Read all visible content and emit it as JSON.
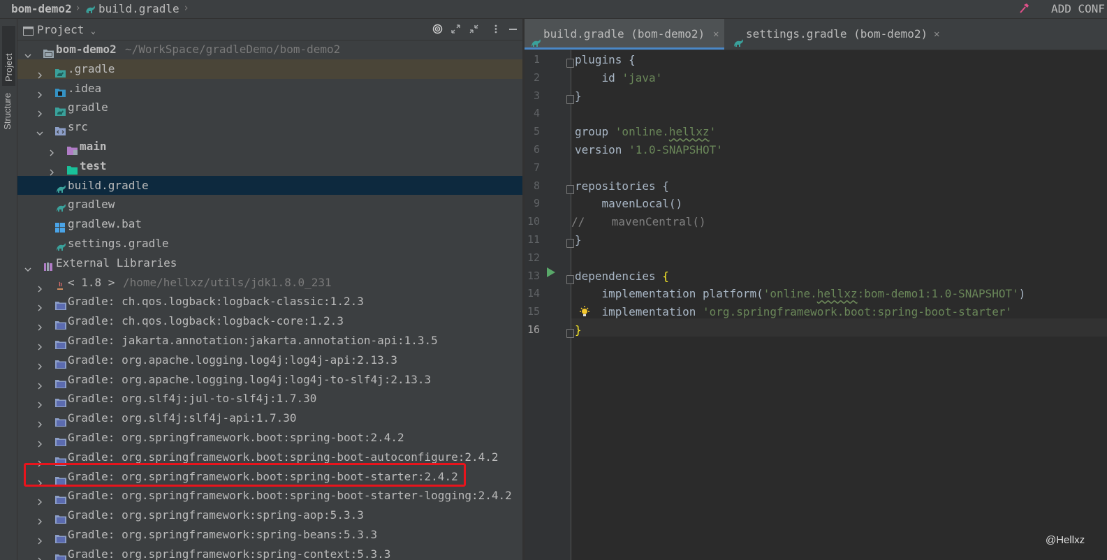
{
  "breadcrumb": {
    "project": "bom-demo2",
    "file": "build.gradle"
  },
  "top_right_label": "ADD CONF",
  "tool_stripe": {
    "project_tab": "Project",
    "structure_tab": "Structure"
  },
  "project_panel": {
    "title": "Project",
    "tree": [
      {
        "label": "bom-demo2",
        "path": "~/WorkSpace/gradleDemo/bom-demo2",
        "indent": 0,
        "expanded": true,
        "icon": "module-folder-icon",
        "bold": true
      },
      {
        "label": ".gradle",
        "indent": 1,
        "expanded": false,
        "icon": "gradle-folder-icon",
        "highlight": true
      },
      {
        "label": ".idea",
        "indent": 1,
        "expanded": false,
        "icon": "idea-folder-icon"
      },
      {
        "label": "gradle",
        "indent": 1,
        "expanded": false,
        "icon": "gradle-folder-icon"
      },
      {
        "label": "src",
        "indent": 1,
        "expanded": true,
        "icon": "source-folder-icon"
      },
      {
        "label": "main",
        "indent": 2,
        "expanded": false,
        "icon": "main-folder-icon",
        "bold": true
      },
      {
        "label": "test",
        "indent": 2,
        "expanded": false,
        "icon": "test-folder-icon",
        "bold": true
      },
      {
        "label": "build.gradle",
        "indent": 1,
        "icon": "gradle-file-icon",
        "selected": true
      },
      {
        "label": "gradlew",
        "indent": 1,
        "icon": "gradle-file-icon"
      },
      {
        "label": "gradlew.bat",
        "indent": 1,
        "icon": "windows-file-icon"
      },
      {
        "label": "settings.gradle",
        "indent": 1,
        "icon": "gradle-file-icon"
      },
      {
        "label": "External Libraries",
        "indent": 0,
        "expanded": true,
        "icon": "library-icon"
      },
      {
        "label": "< 1.8 >",
        "path": "/home/hellxz/utils/jdk1.8.0_231",
        "indent": 1,
        "expanded": false,
        "icon": "jdk-icon"
      },
      {
        "label": "Gradle: ch.qos.logback:logback-classic:1.2.3",
        "indent": 1,
        "expanded": false,
        "icon": "library-folder-icon"
      },
      {
        "label": "Gradle: ch.qos.logback:logback-core:1.2.3",
        "indent": 1,
        "expanded": false,
        "icon": "library-folder-icon"
      },
      {
        "label": "Gradle: jakarta.annotation:jakarta.annotation-api:1.3.5",
        "indent": 1,
        "expanded": false,
        "icon": "library-folder-icon"
      },
      {
        "label": "Gradle: org.apache.logging.log4j:log4j-api:2.13.3",
        "indent": 1,
        "expanded": false,
        "icon": "library-folder-icon"
      },
      {
        "label": "Gradle: org.apache.logging.log4j:log4j-to-slf4j:2.13.3",
        "indent": 1,
        "expanded": false,
        "icon": "library-folder-icon"
      },
      {
        "label": "Gradle: org.slf4j:jul-to-slf4j:1.7.30",
        "indent": 1,
        "expanded": false,
        "icon": "library-folder-icon"
      },
      {
        "label": "Gradle: org.slf4j:slf4j-api:1.7.30",
        "indent": 1,
        "expanded": false,
        "icon": "library-folder-icon"
      },
      {
        "label": "Gradle: org.springframework.boot:spring-boot:2.4.2",
        "indent": 1,
        "expanded": false,
        "icon": "library-folder-icon"
      },
      {
        "label": "Gradle: org.springframework.boot:spring-boot-autoconfigure:2.4.2",
        "indent": 1,
        "expanded": false,
        "icon": "library-folder-icon"
      },
      {
        "label": "Gradle: org.springframework.boot:spring-boot-starter:2.4.2",
        "indent": 1,
        "expanded": false,
        "icon": "library-folder-icon",
        "annotated": true
      },
      {
        "label": "Gradle: org.springframework.boot:spring-boot-starter-logging:2.4.2",
        "indent": 1,
        "expanded": false,
        "icon": "library-folder-icon"
      },
      {
        "label": "Gradle: org.springframework:spring-aop:5.3.3",
        "indent": 1,
        "expanded": false,
        "icon": "library-folder-icon"
      },
      {
        "label": "Gradle: org.springframework:spring-beans:5.3.3",
        "indent": 1,
        "expanded": false,
        "icon": "library-folder-icon"
      },
      {
        "label": "Gradle: org.springframework:spring-context:5.3.3",
        "indent": 1,
        "expanded": false,
        "icon": "library-folder-icon"
      }
    ]
  },
  "editor": {
    "tabs": [
      {
        "label": "build.gradle (bom-demo2)",
        "active": true
      },
      {
        "label": "settings.gradle (bom-demo2)",
        "active": false
      }
    ],
    "current_line": 16,
    "lines": [
      {
        "n": "1",
        "parts": [
          [
            "plain",
            "plugins {"
          ]
        ],
        "fold": true
      },
      {
        "n": "2",
        "parts": [
          [
            "plain",
            "    id "
          ],
          [
            "str",
            "'java'"
          ]
        ]
      },
      {
        "n": "3",
        "parts": [
          [
            "plain",
            "}"
          ]
        ],
        "fold": true
      },
      {
        "n": "4",
        "parts": []
      },
      {
        "n": "5",
        "parts": [
          [
            "plain",
            "group "
          ],
          [
            "str",
            "'online."
          ],
          [
            "strsq",
            "hellxz"
          ],
          [
            "str",
            "'"
          ]
        ]
      },
      {
        "n": "6",
        "parts": [
          [
            "plain",
            "version "
          ],
          [
            "str",
            "'1.0-SNAPSHOT'"
          ]
        ]
      },
      {
        "n": "7",
        "parts": []
      },
      {
        "n": "8",
        "parts": [
          [
            "plain",
            "repositories {"
          ]
        ],
        "fold": true
      },
      {
        "n": "9",
        "parts": [
          [
            "plain",
            "    mavenLocal()"
          ]
        ]
      },
      {
        "n": "10",
        "parts": [
          [
            "cmt",
            "//    mavenCentral()"
          ]
        ],
        "shift": -5
      },
      {
        "n": "11",
        "parts": [
          [
            "plain",
            "}"
          ]
        ],
        "fold": true
      },
      {
        "n": "12",
        "parts": []
      },
      {
        "n": "13",
        "parts": [
          [
            "plain",
            "dependencies "
          ],
          [
            "brace",
            "{"
          ]
        ],
        "fold": true
      },
      {
        "n": "14",
        "parts": [
          [
            "plain",
            "    implementation platform("
          ],
          [
            "str",
            "'online."
          ],
          [
            "strsq",
            "hellxz"
          ],
          [
            "str",
            ":bom-demo1:1.0-SNAPSHOT'"
          ],
          [
            "plain",
            ")"
          ]
        ]
      },
      {
        "n": "15",
        "parts": [
          [
            "plain",
            "    implementation "
          ],
          [
            "str",
            "'org.springframework.boot:spring-boot-starter'"
          ]
        ]
      },
      {
        "n": "16",
        "parts": [
          [
            "brace",
            "}"
          ]
        ],
        "fold": true
      }
    ]
  },
  "watermark": "@Hellxz",
  "colors": {
    "annotation_box": "#e8141c",
    "selection": "#0d293e",
    "accent_tab": "#4a88c7"
  }
}
